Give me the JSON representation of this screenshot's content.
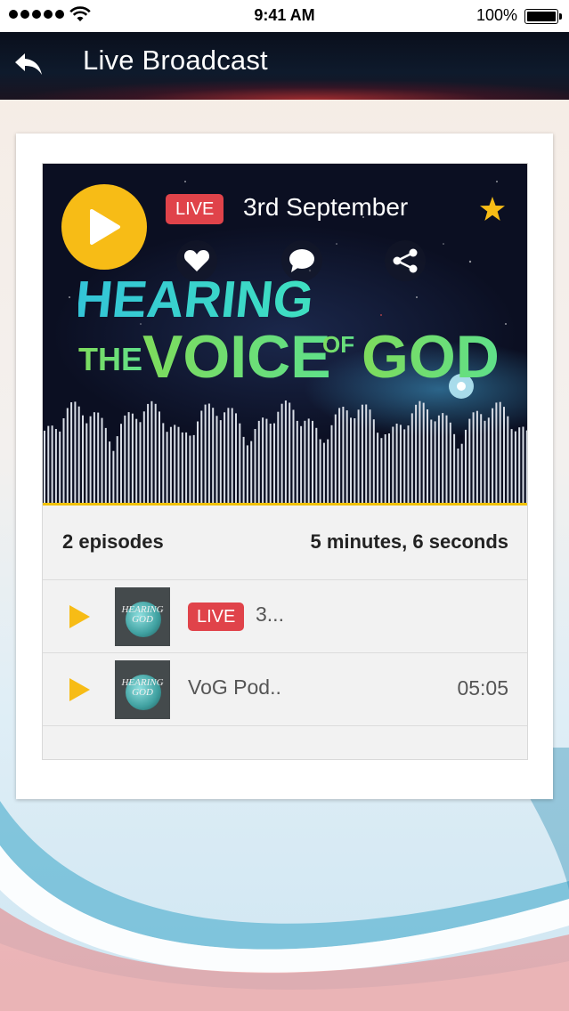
{
  "status_bar": {
    "time": "9:41 AM",
    "battery": "100%"
  },
  "header": {
    "back_icon": "back-arrow-icon",
    "title": "Live Broadcast"
  },
  "player": {
    "live_label": "LIVE",
    "date": "3rd September",
    "title_art": {
      "line1": "HEARING",
      "line2_the": "THE",
      "line2_voice": "VOICE",
      "line2_of": "OF",
      "line2_god": "GOD"
    },
    "actions": [
      "heart-icon",
      "comment-icon",
      "share-icon"
    ],
    "favorite_icon": "star-icon",
    "accent_color": "#f7bc16",
    "live_color": "#e0434a"
  },
  "summary": {
    "episodes": "2 episodes",
    "duration": "5 minutes, 6 seconds"
  },
  "episodes": [
    {
      "live": "LIVE",
      "title": "3...",
      "duration": "",
      "thumb_text": "HEARING GOD"
    },
    {
      "live": "",
      "title": "VoG Pod..",
      "duration": "05:05",
      "thumb_text": "HEARING GOD"
    }
  ]
}
